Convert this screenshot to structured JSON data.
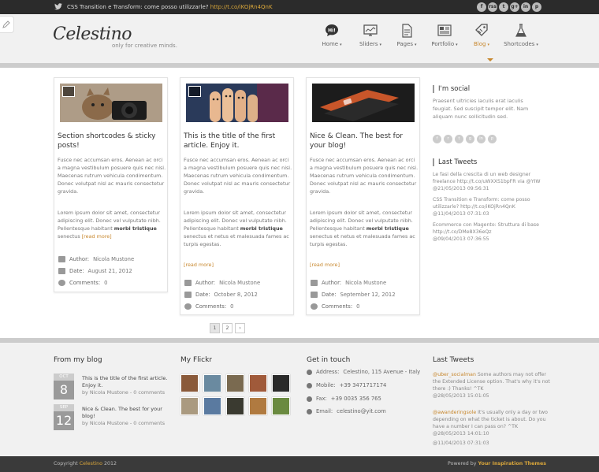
{
  "topbar": {
    "tweet_text": "CSS Transition e Transform: come posso utilizzarle?",
    "tweet_link": "http://t.co/iKOjRn4QnK",
    "socials": [
      "f",
      "rss",
      "t",
      "g+",
      "in",
      "p"
    ]
  },
  "header": {
    "logo": "Celestino",
    "tagline": "only for creative minds.",
    "nav": [
      {
        "label": "Home",
        "icon": "hi-bubble-icon"
      },
      {
        "label": "Sliders",
        "icon": "monitor-icon"
      },
      {
        "label": "Pages",
        "icon": "page-icon"
      },
      {
        "label": "Portfolio",
        "icon": "portfolio-icon"
      },
      {
        "label": "Blog",
        "icon": "tag-icon",
        "active": true
      },
      {
        "label": "Shortcodes",
        "icon": "flask-icon"
      }
    ]
  },
  "posts": [
    {
      "title": "Section shortcodes & sticky posts!",
      "p1": "Fusce nec accumsan eros. Aenean ac orci a magna vestibulum posuere quis nec nisi. Maecenas rutrum vehicula condimentum. Donec volutpat nisl ac mauris consectetur gravida.",
      "p2a": "Lorem ipsum dolor sit amet, consectetur adipiscing elit. Donec vel vulputate nibh. Pellentesque habitant ",
      "p2b": "morbi tristique",
      "p2c": " senectus ",
      "more": "[read more]",
      "author_label": "Author:",
      "author": "Nicola Mustone",
      "date_label": "Date:",
      "date": "August 21, 2012",
      "comments_label": "Comments:",
      "comments": "0"
    },
    {
      "title": "This is the title of the first article. Enjoy it.",
      "p1": "Fusce nec accumsan eros. Aenean ac orci a magna vestibulum posuere quis nec nisi. Maecenas rutrum vehicula condimentum. Donec volutpat nisl ac mauris consectetur gravida.",
      "p2a": "Lorem ipsum dolor sit amet, consectetur adipiscing elit. Donec vel vulputate nibh. Pellentesque habitant ",
      "p2b": "morbi tristique",
      "p2c": " senectus et netus et malesuada fames ac turpis egestas.",
      "more": "[read more]",
      "author_label": "Author:",
      "author": "Nicola Mustone",
      "date_label": "Date:",
      "date": "October 8, 2012",
      "comments_label": "Comments:",
      "comments": "0"
    },
    {
      "title": "Nice & Clean. The best for your blog!",
      "p1": "Fusce nec accumsan eros. Aenean ac orci a magna vestibulum posuere quis nec nisi. Maecenas rutrum vehicula condimentum. Donec volutpat nisl ac mauris consectetur gravida.",
      "p2a": "Lorem ipsum dolor sit amet, consectetur adipiscing elit. Donec vel vulputate nibh. Pellentesque habitant ",
      "p2b": "morbi tristique",
      "p2c": " senectus et netus et malesuada fames ac turpis egestas.",
      "more": "[read more]",
      "author_label": "Author:",
      "author": "Nicola Mustone",
      "date_label": "Date:",
      "date": "September 12, 2012",
      "comments_label": "Comments:",
      "comments": "0"
    }
  ],
  "pagination": {
    "current": "1",
    "next_page": "2",
    "next": "›"
  },
  "sidebar": {
    "social_title": "I'm social",
    "social_text": "Praesent ultricies iaculis erat iaculis feugiat. Sed suscipit tempor elit. Nam aliquam nunc sollicitudin sed.",
    "tweets_title": "Last Tweets",
    "tweets": [
      {
        "text": "Le fasi della crescita di un web designer freelance ",
        "link": "http://t.co/uWXXS1bpFR via @YIW",
        "date": "@21/05/2013 09:56:31"
      },
      {
        "text": "CSS Transition e Transform: come posso utilizzarle? ",
        "link": "http://t.co/iKOjRn4QnK",
        "date": "@11/04/2013 07:31:03"
      },
      {
        "text": "Ecommerce con Magento: Struttura di base ",
        "link": "http://t.co/DMe8X36eQz",
        "date": "@09/04/2013 07:36:55"
      }
    ]
  },
  "footer": {
    "blog_title": "From my blog",
    "blog": [
      {
        "month": "OCT",
        "day": "8",
        "title": "This is the title of the first article. Enjoy it.",
        "by": "by Nicola Mustone - 0 comments"
      },
      {
        "month": "SEP",
        "day": "12",
        "title": "Nice & Clean. The best for your blog!",
        "by": "by Nicola Mustone - 0 comments"
      }
    ],
    "flickr_title": "My Flickr",
    "flickr_colors": [
      "#8a5a3a",
      "#6a8aa0",
      "#7a6a50",
      "#a05a3a",
      "#2a2a2a",
      "#aa9a80",
      "#5a7aa0",
      "#3a3a30",
      "#b07a40",
      "#6a8a40"
    ],
    "contact_title": "Get in touch",
    "contact": [
      {
        "label": "Address:",
        "value": "Celestino, 115 Avenue - Italy",
        "icon": "pin-icon"
      },
      {
        "label": "Mobile:",
        "value": "+39 3471717174",
        "icon": "phone-icon"
      },
      {
        "label": "Fax:",
        "value": "+39 0035 356 765",
        "icon": "fax-icon"
      },
      {
        "label": "Email:",
        "value": "celestino@yit.com",
        "icon": "mail-icon"
      }
    ],
    "tweets_title": "Last Tweets",
    "tweets": [
      {
        "handle": "@uber_socialman",
        "text": " Some authors may not offer the Extended License option. That's why it's not there :) Thanks! ^TK",
        "date": "@28/05/2013 15:01:05"
      },
      {
        "handle": "@awanderingsole",
        "text": " It's usually only a day or two depending on what the ticket is about. Do you have a number I can pass on? ^TK",
        "date": "@28/05/2013 14:01:10"
      },
      {
        "handle": "",
        "text": "",
        "date": "@11/04/2013 07:31:03"
      }
    ]
  },
  "bottom": {
    "copyright_pre": "Copyright ",
    "copyright_brand": "Celestino",
    "copyright_year": " 2012",
    "powered_pre": "Powered by ",
    "powered_brand": "Your Inspiration Themes"
  },
  "colors": {
    "accent": "#c7872d",
    "topbar": "#2b2b2b",
    "header": "#f1f1f1",
    "footer": "#f1f1f1"
  }
}
